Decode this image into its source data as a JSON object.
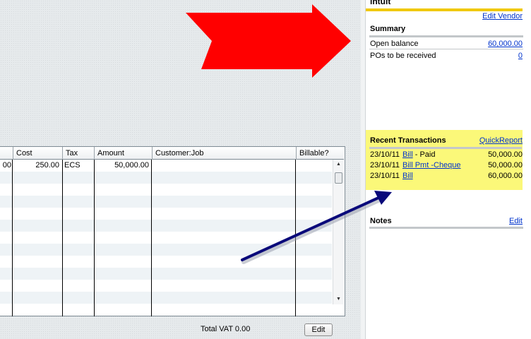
{
  "grid": {
    "columns": [
      "",
      "Cost",
      "Tax",
      "Amount",
      "Customer:Job",
      "Billable?"
    ],
    "first_row": {
      "qty": "00",
      "cost": "250.00",
      "tax": "ECS",
      "amount": "50,000.00",
      "customer": "",
      "billable": ""
    },
    "scroll_up_icon": "triangle-up",
    "scroll_down_icon": "triangle-down"
  },
  "footer": {
    "total_vat_label": "Total VAT",
    "total_vat_value": "0.00",
    "edit_button": "Edit"
  },
  "side_panel": {
    "brand": "intuit",
    "edit_vendor": "Edit Vendor",
    "summary": {
      "title": "Summary",
      "items": [
        {
          "label": "Open balance",
          "value": "60,000.00"
        },
        {
          "label": "POs to be received",
          "value": "0"
        }
      ]
    },
    "recent": {
      "title": "Recent Transactions",
      "quickreport": "QuickReport",
      "highlight_color": "#fbf879",
      "transactions": [
        {
          "date": "23/10/11",
          "type": "Bill",
          "suffix": " - Paid",
          "amount": "50,000.00"
        },
        {
          "date": "23/10/11",
          "type": "Bill Pmt -Cheque",
          "suffix": "",
          "amount": "50,000.00"
        },
        {
          "date": "23/10/11",
          "type": "Bill",
          "suffix": "",
          "amount": "60,000.00"
        }
      ]
    },
    "notes": {
      "title": "Notes",
      "edit": "Edit"
    }
  },
  "annotations": {
    "big_arrow_color": "#ff0000",
    "pointer_arrow_color": "#0a0a7a",
    "icons": [
      "red-arrow-icon",
      "navy-pointer-arrow-icon"
    ]
  }
}
